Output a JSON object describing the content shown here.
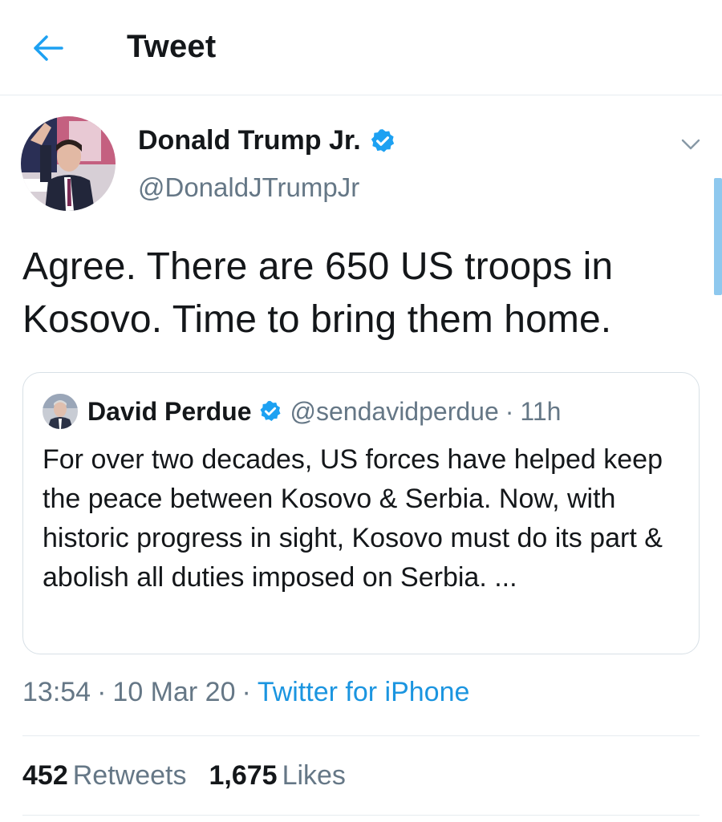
{
  "header": {
    "title": "Tweet",
    "back_icon": "arrow-left-icon"
  },
  "colors": {
    "accent": "#1da1f2",
    "link": "#1b95e0",
    "secondary_text": "#657786",
    "border": "#e6ecf0"
  },
  "author": {
    "name": "Donald Trump Jr.",
    "handle": "@DonaldJTrumpJr",
    "verified_icon": "verified-badge-icon",
    "menu_icon": "chevron-down-icon"
  },
  "tweet": {
    "text": "Agree. There are 650 US troops in Kosovo. Time to bring them home."
  },
  "quoted": {
    "name": "David Perdue",
    "handle": "@sendavidperdue",
    "separator": "·",
    "time": "11h",
    "text": "For over two decades, US forces have helped keep the peace between Kosovo & Serbia. Now, with historic progress in sight, Kosovo must do its part & abolish all duties imposed on Serbia. ..."
  },
  "meta": {
    "time": "13:54",
    "separator": "·",
    "date": "10 Mar 20",
    "source": "Twitter for iPhone"
  },
  "stats": {
    "retweets_count": "452",
    "retweets_label": "Retweets",
    "likes_count": "1,675",
    "likes_label": "Likes"
  }
}
